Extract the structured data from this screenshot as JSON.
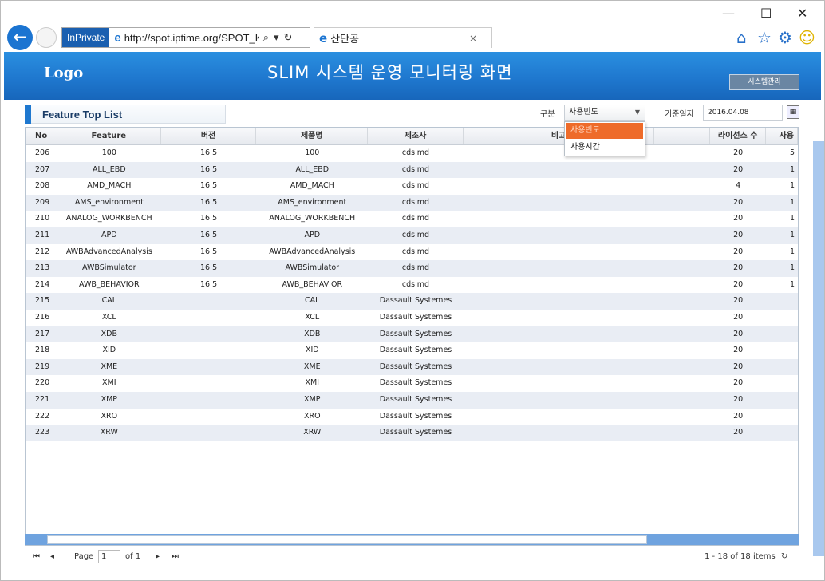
{
  "browser": {
    "inprivate": "InPrivate",
    "url": "http://spot.iptime.org/SPOT_K",
    "tab_title": "산단공",
    "tab_close": "×",
    "minimize": "—",
    "maximize": "☐",
    "close": "✕"
  },
  "header": {
    "logo": "Logo",
    "title": "SLIM 시스템 운영 모니터링 화면",
    "sys_button": "시스템관리"
  },
  "panel": {
    "title": "Feature Top List",
    "category_label": "구분",
    "category_value": "사용빈도",
    "dropdown_options": [
      "사용빈도",
      "사용시간"
    ],
    "date_label": "기준일자",
    "date_value": "2016.04.08"
  },
  "grid": {
    "headers": [
      "No",
      "Feature",
      "버전",
      "제품명",
      "제조사",
      "비고",
      "",
      "라이선스 수",
      "사용"
    ],
    "rows": [
      [
        "206",
        "100",
        "16.5",
        "100",
        "cdslmd",
        "",
        "",
        "20",
        "5"
      ],
      [
        "207",
        "ALL_EBD",
        "16.5",
        "ALL_EBD",
        "cdslmd",
        "",
        "",
        "20",
        "1"
      ],
      [
        "208",
        "AMD_MACH",
        "16.5",
        "AMD_MACH",
        "cdslmd",
        "",
        "",
        "4",
        "1"
      ],
      [
        "209",
        "AMS_environment",
        "16.5",
        "AMS_environment",
        "cdslmd",
        "",
        "",
        "20",
        "1"
      ],
      [
        "210",
        "ANALOG_WORKBENCH",
        "16.5",
        "ANALOG_WORKBENCH",
        "cdslmd",
        "",
        "",
        "20",
        "1"
      ],
      [
        "211",
        "APD",
        "16.5",
        "APD",
        "cdslmd",
        "",
        "",
        "20",
        "1"
      ],
      [
        "212",
        "AWBAdvancedAnalysis",
        "16.5",
        "AWBAdvancedAnalysis",
        "cdslmd",
        "",
        "",
        "20",
        "1"
      ],
      [
        "213",
        "AWBSimulator",
        "16.5",
        "AWBSimulator",
        "cdslmd",
        "",
        "",
        "20",
        "1"
      ],
      [
        "214",
        "AWB_BEHAVIOR",
        "16.5",
        "AWB_BEHAVIOR",
        "cdslmd",
        "",
        "",
        "20",
        "1"
      ],
      [
        "215",
        "CAL",
        "",
        "CAL",
        "Dassault Systemes",
        "",
        "",
        "20",
        ""
      ],
      [
        "216",
        "XCL",
        "",
        "XCL",
        "Dassault Systemes",
        "",
        "",
        "20",
        ""
      ],
      [
        "217",
        "XDB",
        "",
        "XDB",
        "Dassault Systemes",
        "",
        "",
        "20",
        ""
      ],
      [
        "218",
        "XID",
        "",
        "XID",
        "Dassault Systemes",
        "",
        "",
        "20",
        ""
      ],
      [
        "219",
        "XME",
        "",
        "XME",
        "Dassault Systemes",
        "",
        "",
        "20",
        ""
      ],
      [
        "220",
        "XMI",
        "",
        "XMI",
        "Dassault Systemes",
        "",
        "",
        "20",
        ""
      ],
      [
        "221",
        "XMP",
        "",
        "XMP",
        "Dassault Systemes",
        "",
        "",
        "20",
        ""
      ],
      [
        "222",
        "XRO",
        "",
        "XRO",
        "Dassault Systemes",
        "",
        "",
        "20",
        ""
      ],
      [
        "223",
        "XRW",
        "",
        "XRW",
        "Dassault Systemes",
        "",
        "",
        "20",
        ""
      ]
    ]
  },
  "pager": {
    "page_label": "Page",
    "page_value": "1",
    "of_label": "of 1",
    "items_text": "1 - 18 of 18 items"
  }
}
